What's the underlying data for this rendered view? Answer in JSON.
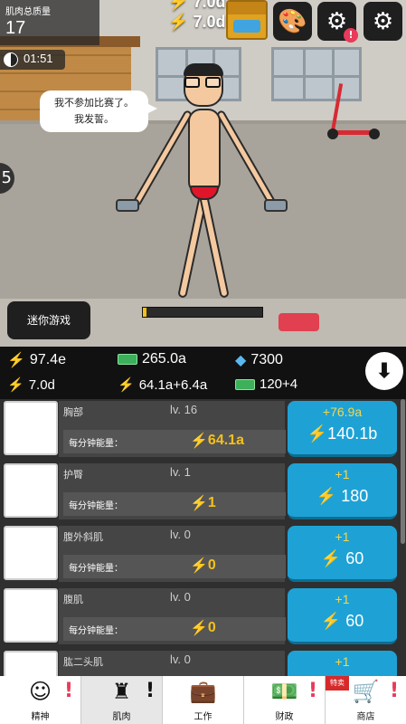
{
  "top": {
    "stat_label": "肌肉总质量",
    "stat_value": "17",
    "timer": "01:51",
    "cur1": "7.0d",
    "cur2": "7.0d"
  },
  "scene": {
    "speech_line1": "我不参加比赛了。",
    "speech_line2": "我发誓。",
    "mini_game_label": "迷你游戏",
    "progress_fraction": 0.03
  },
  "resources": {
    "energy": "97.4e",
    "cash": "265.0a",
    "gems": "7300",
    "energy_per_tap": "7.0d",
    "energy_rate": "64.1a+6.4a",
    "cash_rate": "120+4"
  },
  "muscles": [
    {
      "name": "胸部",
      "level": "lv. 16",
      "rate_label": "每分钟能量：",
      "rate": "64.1a",
      "gain": "+76.9a",
      "cost": "140.1b"
    },
    {
      "name": "护臀",
      "level": "lv. 1",
      "rate_label": "每分钟能量：",
      "rate": "1",
      "gain": "+1",
      "cost": "180"
    },
    {
      "name": "腹外斜肌",
      "level": "lv. 0",
      "rate_label": "每分钟能量：",
      "rate": "0",
      "gain": "+1",
      "cost": "60"
    },
    {
      "name": "腹肌",
      "level": "lv. 0",
      "rate_label": "每分钟能量：",
      "rate": "0",
      "gain": "+1",
      "cost": "60"
    },
    {
      "name": "肱二头肌",
      "level": "lv. 0",
      "rate_label": "",
      "rate": "",
      "gain": "+1",
      "cost": ""
    }
  ],
  "nav": [
    {
      "label": "精神",
      "icon": "brain-icon"
    },
    {
      "label": "肌肉",
      "icon": "body-icon"
    },
    {
      "label": "工作",
      "icon": "briefcase-icon"
    },
    {
      "label": "财政",
      "icon": "money-icon"
    },
    {
      "label": "商店",
      "icon": "cart-icon",
      "ribbon": "特卖"
    }
  ],
  "colors": {
    "accent": "#1ea2d6",
    "energy": "#f3c01c",
    "alert": "#e83a5a"
  }
}
